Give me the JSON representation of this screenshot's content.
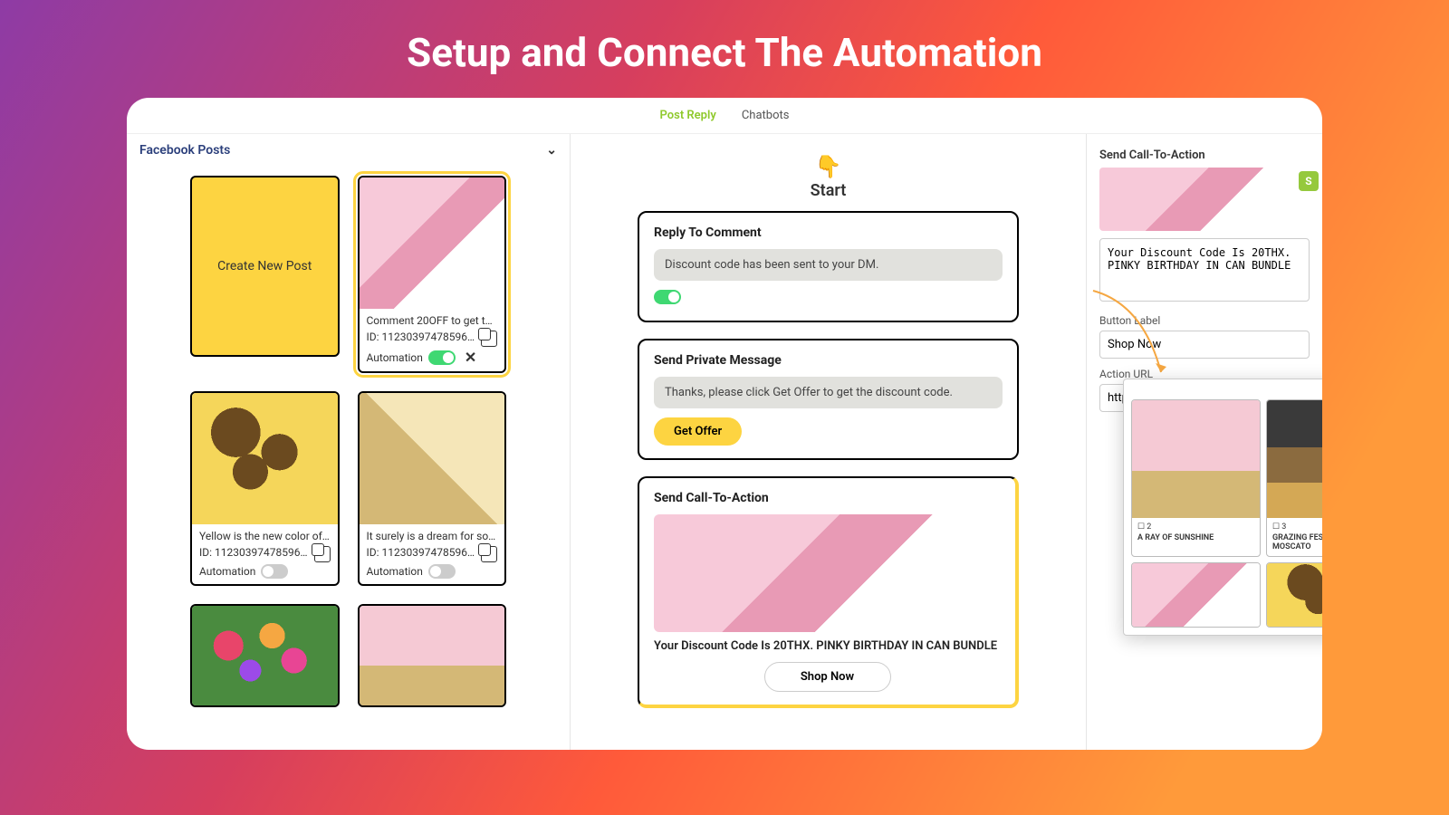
{
  "page_title": "Setup and Connect The Automation",
  "tabs": {
    "post_reply": "Post Reply",
    "chatbots": "Chatbots"
  },
  "left": {
    "header": "Facebook Posts",
    "create_label": "Create New Post",
    "posts": [
      {
        "caption": "Comment 20OFF to get the …",
        "id_label": "ID: 112303974785969…",
        "auto_label": "Automation",
        "auto_on": true,
        "selected": true,
        "img": "pinkbouq"
      },
      {
        "caption": "Yellow is the new color of lov…",
        "id_label": "ID: 112303974785969…",
        "auto_label": "Automation",
        "auto_on": false,
        "img": "sunflower"
      },
      {
        "caption": "It surely is a dream for som…",
        "id_label": "ID: 112303974785969…",
        "auto_label": "Automation",
        "auto_on": false,
        "img": "giftbox"
      },
      {
        "caption": "",
        "id_label": "",
        "auto_label": "",
        "img": "colorful",
        "partial": true
      },
      {
        "caption": "",
        "id_label": "",
        "auto_label": "",
        "img": "rosebox",
        "partial": true
      }
    ]
  },
  "flow": {
    "emoji": "👇",
    "start": "Start",
    "reply_title": "Reply To Comment",
    "reply_msg": "Discount code has been sent to your DM.",
    "pm_title": "Send Private Message",
    "pm_msg": "Thanks, please click Get Offer to get the discount code.",
    "pm_btn": "Get Offer",
    "cta_title": "Send Call-To-Action",
    "cta_text": "Your Discount Code Is 20THX. PINKY BIRTHDAY IN CAN BUNDLE",
    "cta_btn": "Shop Now"
  },
  "right": {
    "title": "Send Call-To-Action",
    "textarea": "Your Discount Code Is 20THX. PINKY BIRTHDAY IN CAN BUNDLE",
    "button_label_lbl": "Button Label",
    "button_label_val": "Shop Now",
    "action_url_lbl": "Action URL",
    "action_url_val": "https://flowercool.m"
  },
  "picker": {
    "products": [
      {
        "num": "2",
        "name": "A RAY OF SUNSHINE",
        "img": "rosebox",
        "tall": true
      },
      {
        "num": "3",
        "name": "GRAZING FESTIVE BOX WITH MOSCATO",
        "img": "hamper",
        "tall": true
      },
      {
        "num": "",
        "name": "",
        "img": "pinkbouq",
        "tall": false
      },
      {
        "num": "",
        "name": "",
        "img": "sunflower",
        "tall": false
      }
    ]
  }
}
